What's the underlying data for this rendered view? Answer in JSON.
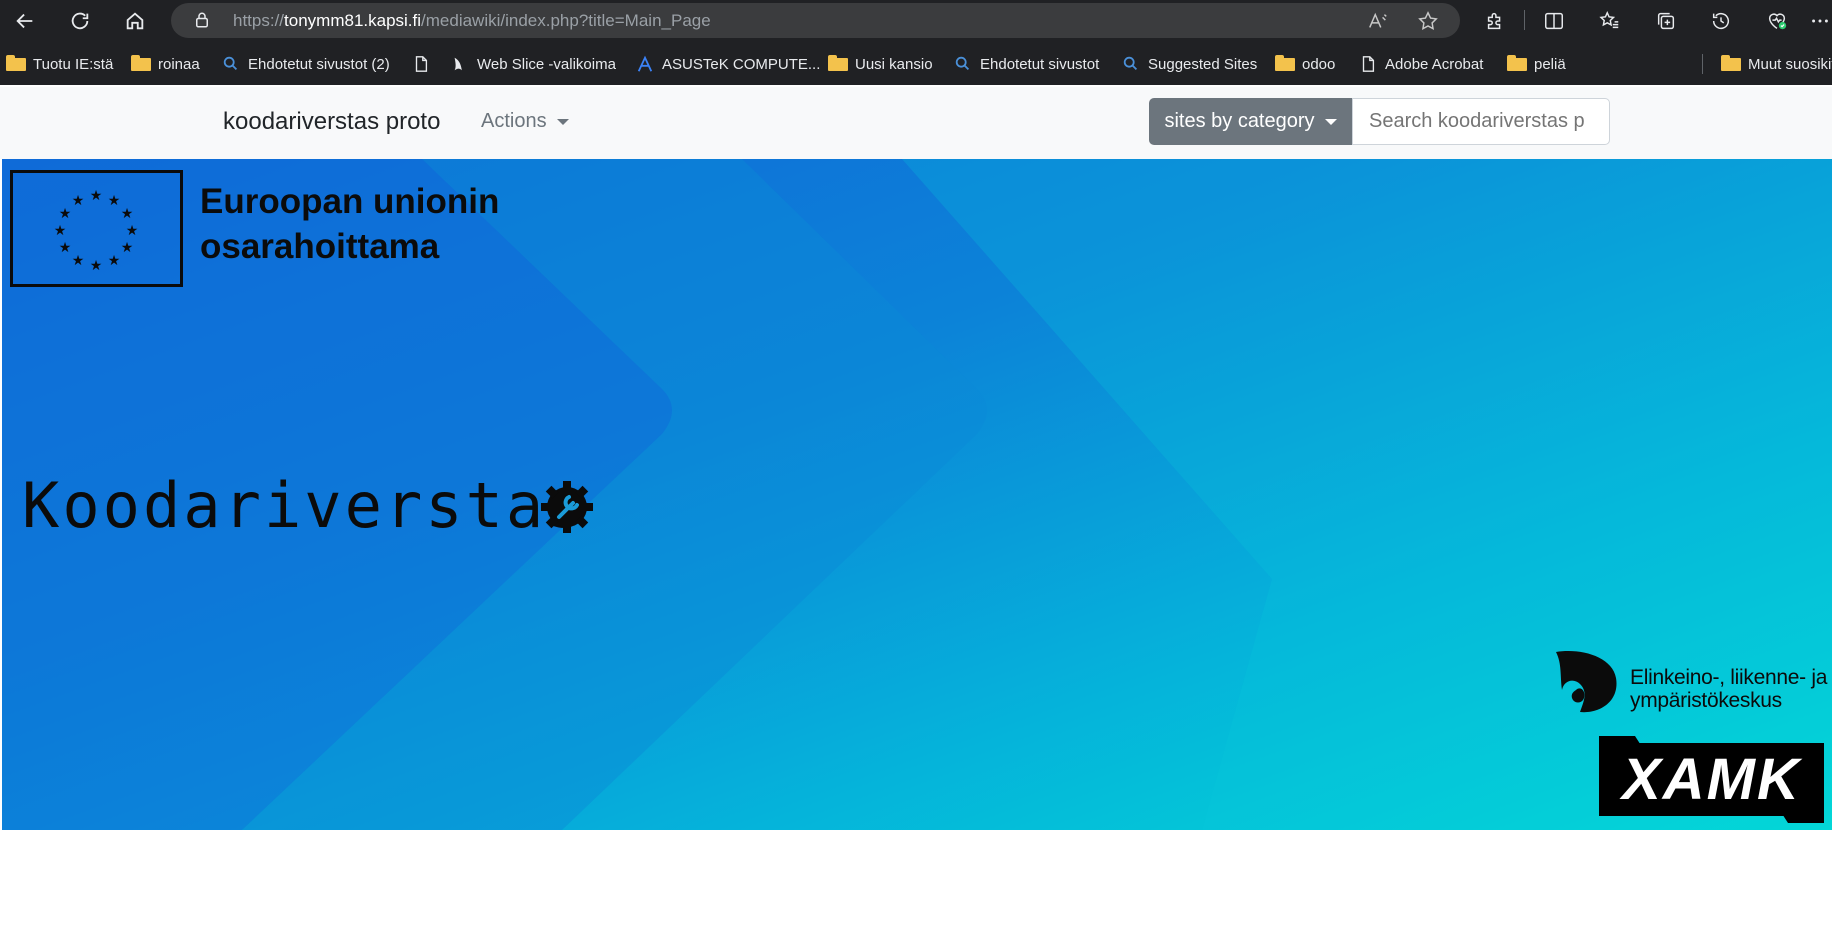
{
  "browser": {
    "url_scheme": "https://",
    "url_host": "tonymm81.kapsi.fi",
    "url_path": "/mediawiki/index.php?title=Main_Page",
    "bookmarks": [
      {
        "label": "Tuotu IE:stä",
        "icon": "folder-icon"
      },
      {
        "label": "roinaa",
        "icon": "folder-icon"
      },
      {
        "label": "Ehdotetut sivustot (2)",
        "icon": "search-icon"
      },
      {
        "label": "",
        "icon": "page-icon"
      },
      {
        "label": "Web Slice -valikoima",
        "icon": "web-slice-icon"
      },
      {
        "label": "ASUSTeK COMPUTE...",
        "icon": "asus-icon"
      },
      {
        "label": "Uusi kansio",
        "icon": "folder-icon"
      },
      {
        "label": "Ehdotetut sivustot",
        "icon": "search-icon"
      },
      {
        "label": "Suggested Sites",
        "icon": "search-icon"
      },
      {
        "label": "odoo",
        "icon": "folder-icon"
      },
      {
        "label": "Adobe Acrobat",
        "icon": "page-icon"
      },
      {
        "label": "peliä",
        "icon": "folder-icon"
      },
      {
        "label": "Muut suosikit",
        "icon": "folder-icon"
      }
    ]
  },
  "navbar": {
    "brand": "koodariverstas proto",
    "actions_label": "Actions",
    "category_button": "sites by category",
    "search_placeholder": "Search koodariverstas p"
  },
  "hero": {
    "eu_line1": "Euroopan unionin",
    "eu_line2": "osarahoittama",
    "title": "Koodariverstas",
    "ely_line1": "Elinkeino-, liikenne- ja",
    "ely_line2": "ympäristökeskus",
    "xamk": "XAMK"
  },
  "colors": {
    "chrome_bg": "#202124",
    "navbar_bg": "#f8f9fa",
    "button_bg": "#6c757d",
    "hero_start": "#1066d8",
    "hero_end": "#02dcd6"
  }
}
